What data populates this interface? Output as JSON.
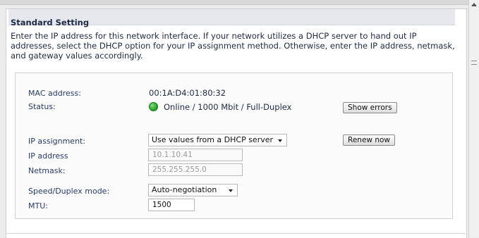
{
  "section": {
    "title": "Standard Setting",
    "intro": "Enter the IP address for this network interface. If your network utilizes a DHCP server to hand out IP addresses, select the DHCP option for your IP assignment method. Otherwise, enter the IP address, netmask, and gateway values accordingly."
  },
  "fields": {
    "mac_label": "MAC address:",
    "mac_value": "00:1A:D4:01:80:32",
    "status_label": "Status:",
    "status_value": "Online / 1000 Mbit / Full-Duplex",
    "status_color": "#1f9a24",
    "show_errors_label": "Show errors",
    "ip_assignment_label": "IP assignment:",
    "ip_assignment_value": "Use values from a DHCP server",
    "renew_label": "Renew now",
    "ip_address_label": "IP address",
    "ip_address_value": "10.1.10.41",
    "netmask_label": "Netmask:",
    "netmask_value": "255.255.255.0",
    "speed_label": "Speed/Duplex mode:",
    "speed_value": "Auto-negotiation",
    "mtu_label": "MTU:",
    "mtu_value": "1500"
  }
}
